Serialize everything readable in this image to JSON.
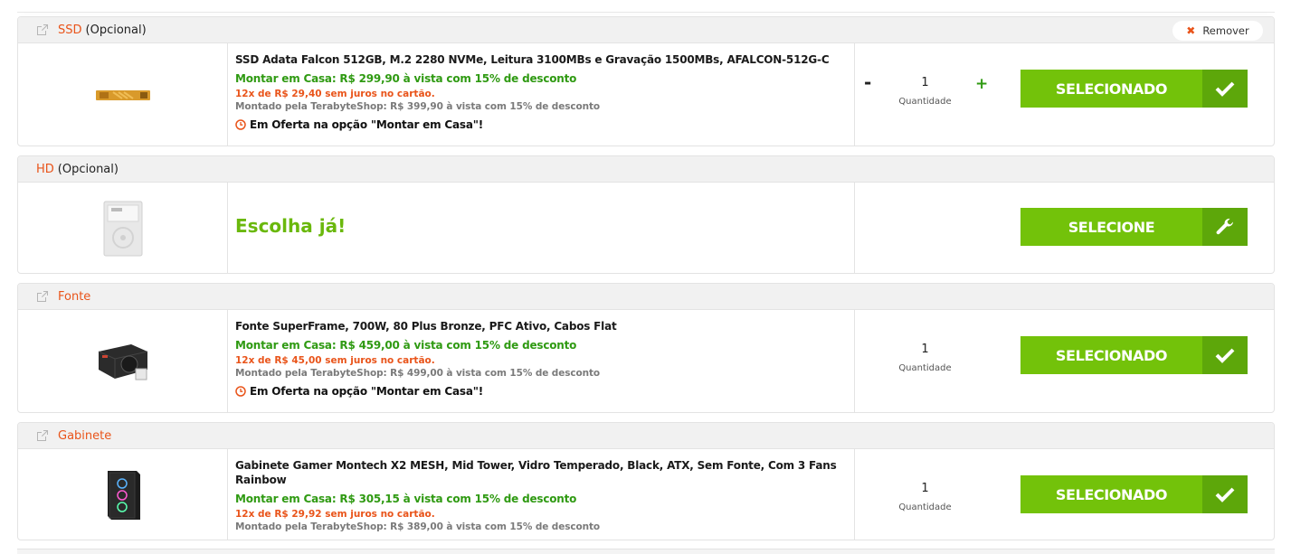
{
  "sections": {
    "ssd": {
      "category": "SSD",
      "optional": "(Opcional)",
      "remove_label": "Remover",
      "title": "SSD Adata Falcon 512GB, M.2 2280 NVMe, Leitura 3100MBs e Gravação 1500MBs, AFALCON-512G-C",
      "montar": "Montar em Casa: R$ 299,90 à vista com 15% de desconto",
      "parcel": "12x de R$ 29,40 sem juros no cartão.",
      "tbshop": "Montado pela TerabyteShop: R$ 399,90 à vista com 15% de desconto",
      "oferta": "Em Oferta na opção \"Montar em Casa\"!",
      "qty_minus": "-",
      "qty_value": "1",
      "qty_plus": "+",
      "qty_label": "Quantidade",
      "button": "SELECIONADO"
    },
    "hd": {
      "category": "HD",
      "optional": "(Opcional)",
      "choose": "Escolha já!",
      "button": "SELECIONE"
    },
    "fonte": {
      "category": "Fonte",
      "title": "Fonte SuperFrame, 700W, 80 Plus Bronze, PFC Ativo, Cabos Flat",
      "montar": "Montar em Casa: R$ 459,00 à vista com 15% de desconto",
      "parcel": "12x de R$ 45,00 sem juros no cartão.",
      "tbshop": "Montado pela TerabyteShop: R$ 499,00 à vista com 15% de desconto",
      "oferta": "Em Oferta na opção \"Montar em Casa\"!",
      "qty_value": "1",
      "qty_label": "Quantidade",
      "button": "SELECIONADO"
    },
    "gabinete": {
      "category": "Gabinete",
      "title": "Gabinete Gamer Montech X2 MESH, Mid Tower, Vidro Temperado, Black, ATX, Sem Fonte, Com 3 Fans Rainbow",
      "montar": "Montar em Casa: R$ 305,15 à vista com 15% de desconto",
      "parcel": "12x de R$ 29,92 sem juros no cartão.",
      "tbshop": "Montado pela TerabyteShop: R$ 389,00 à vista com 15% de desconto",
      "qty_value": "1",
      "qty_label": "Quantidade",
      "button": "SELECIONADO"
    }
  },
  "colors": {
    "accent_orange": "#e9541a",
    "price_green": "#2f9a12",
    "button_green": "#73c20a",
    "button_icon_green": "#5da70a"
  },
  "icons": [
    "external-link-icon",
    "remove-x-icon",
    "clock-icon",
    "check-icon",
    "wrench-icon"
  ]
}
